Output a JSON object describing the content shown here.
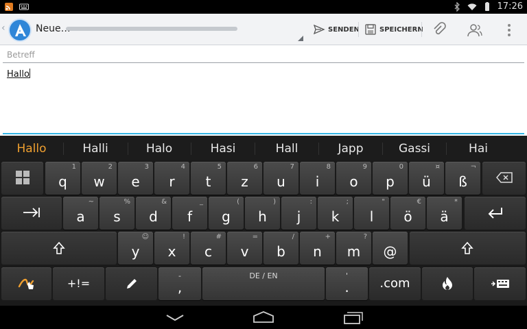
{
  "status": {
    "time": "17:26"
  },
  "header": {
    "title": "Neue…",
    "send_label": "SENDEN",
    "save_label": "SPEICHERN"
  },
  "compose": {
    "subject_placeholder": "Betreff",
    "body_text": "Hallo"
  },
  "keyboard": {
    "suggestions": [
      "Hallo",
      "Halli",
      "Halo",
      "Hasi",
      "Hall",
      "Japp",
      "Gassi",
      "Hai"
    ],
    "row1": [
      {
        "k": "q",
        "h": "1"
      },
      {
        "k": "w",
        "h": "2"
      },
      {
        "k": "e",
        "h": "3"
      },
      {
        "k": "r",
        "h": "4"
      },
      {
        "k": "t",
        "h": "5"
      },
      {
        "k": "z",
        "h": "6"
      },
      {
        "k": "u",
        "h": "7"
      },
      {
        "k": "i",
        "h": "8"
      },
      {
        "k": "o",
        "h": "9"
      },
      {
        "k": "p",
        "h": "0"
      },
      {
        "k": "ü",
        "h": "¤"
      },
      {
        "k": "ß",
        "h": "¬"
      }
    ],
    "row2": [
      {
        "k": "a",
        "h": "~"
      },
      {
        "k": "s",
        "h": "%"
      },
      {
        "k": "d",
        "h": "&"
      },
      {
        "k": "f",
        "h": "_"
      },
      {
        "k": "g",
        "h": "("
      },
      {
        "k": "h",
        "h": ")"
      },
      {
        "k": "j",
        "h": ":"
      },
      {
        "k": "k",
        "h": ";"
      },
      {
        "k": "l",
        "h": "\""
      },
      {
        "k": "ö",
        "h": "€"
      },
      {
        "k": "ä",
        "h": "*"
      }
    ],
    "row3": [
      {
        "k": "y",
        "h": "☺"
      },
      {
        "k": "x",
        "h": "!"
      },
      {
        "k": "c",
        "h": "#"
      },
      {
        "k": "v",
        "h": "="
      },
      {
        "k": "b",
        "h": "/"
      },
      {
        "k": "n",
        "h": "+"
      },
      {
        "k": "m",
        "h": "?"
      },
      {
        "k": "@",
        "h": ""
      }
    ],
    "symbols_label": "+!=",
    "comma_top": "-",
    "comma_main": ",",
    "space_label": "DE / EN",
    "period_top": "'",
    "period_main": ".",
    "dotcom_label": ".com"
  }
}
